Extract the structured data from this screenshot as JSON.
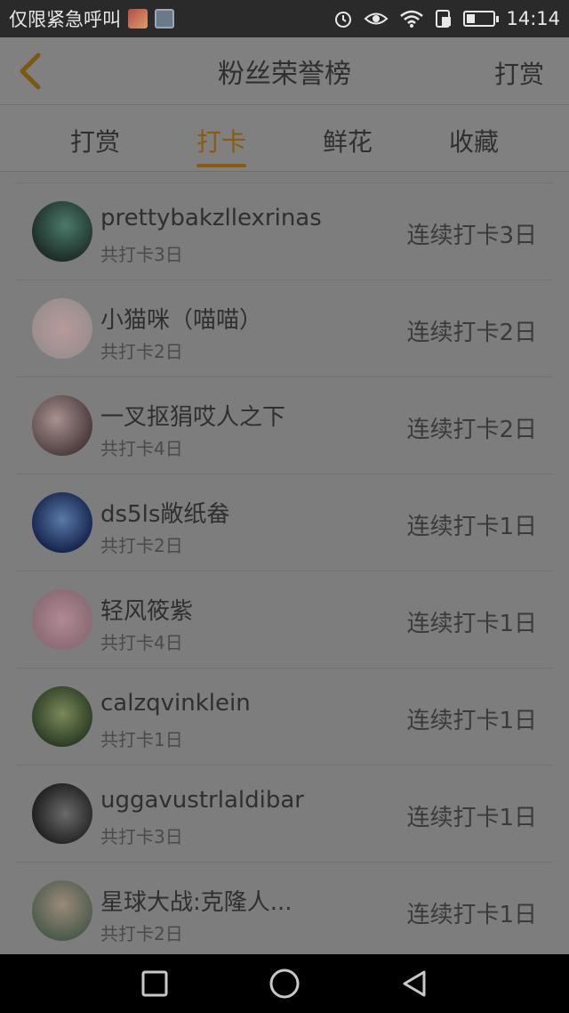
{
  "status_bar": {
    "carrier": "仅限紧急呼叫",
    "time": "14:14",
    "icons": [
      "notification-image-icon",
      "screenshot-icon",
      "alarm-icon",
      "eye-comfort-icon",
      "wifi-icon",
      "sim-icon",
      "battery-icon"
    ]
  },
  "header": {
    "title": "粉丝荣誉榜",
    "right_action": "打赏"
  },
  "tabs": [
    {
      "label": "打赏",
      "active": false
    },
    {
      "label": "打卡",
      "active": true
    },
    {
      "label": "鲜花",
      "active": false
    },
    {
      "label": "收藏",
      "active": false
    }
  ],
  "rows": [
    {
      "name": "prettybakzllexrinas",
      "total": "共打卡3日",
      "streak": "连续打卡3日"
    },
    {
      "name": "小猫咪（喵喵）",
      "total": "共打卡2日",
      "streak": "连续打卡2日"
    },
    {
      "name": "一叉抠狷哎人之下",
      "total": "共打卡4日",
      "streak": "连续打卡2日"
    },
    {
      "name": "ds5ls敞纸畚",
      "total": "共打卡2日",
      "streak": "连续打卡1日"
    },
    {
      "name": "轻风筱紫",
      "total": "共打卡4日",
      "streak": "连续打卡1日"
    },
    {
      "name": "calzqvinklein",
      "total": "共打卡1日",
      "streak": "连续打卡1日"
    },
    {
      "name": "uggavustrlaldibar",
      "total": "共打卡3日",
      "streak": "连续打卡1日"
    },
    {
      "name": "星球大战:克隆人...",
      "total": "共打卡2日",
      "streak": "连续打卡1日"
    }
  ],
  "colors": {
    "accent": "#8a5a10",
    "overlay_background": "#7d7d7d"
  }
}
